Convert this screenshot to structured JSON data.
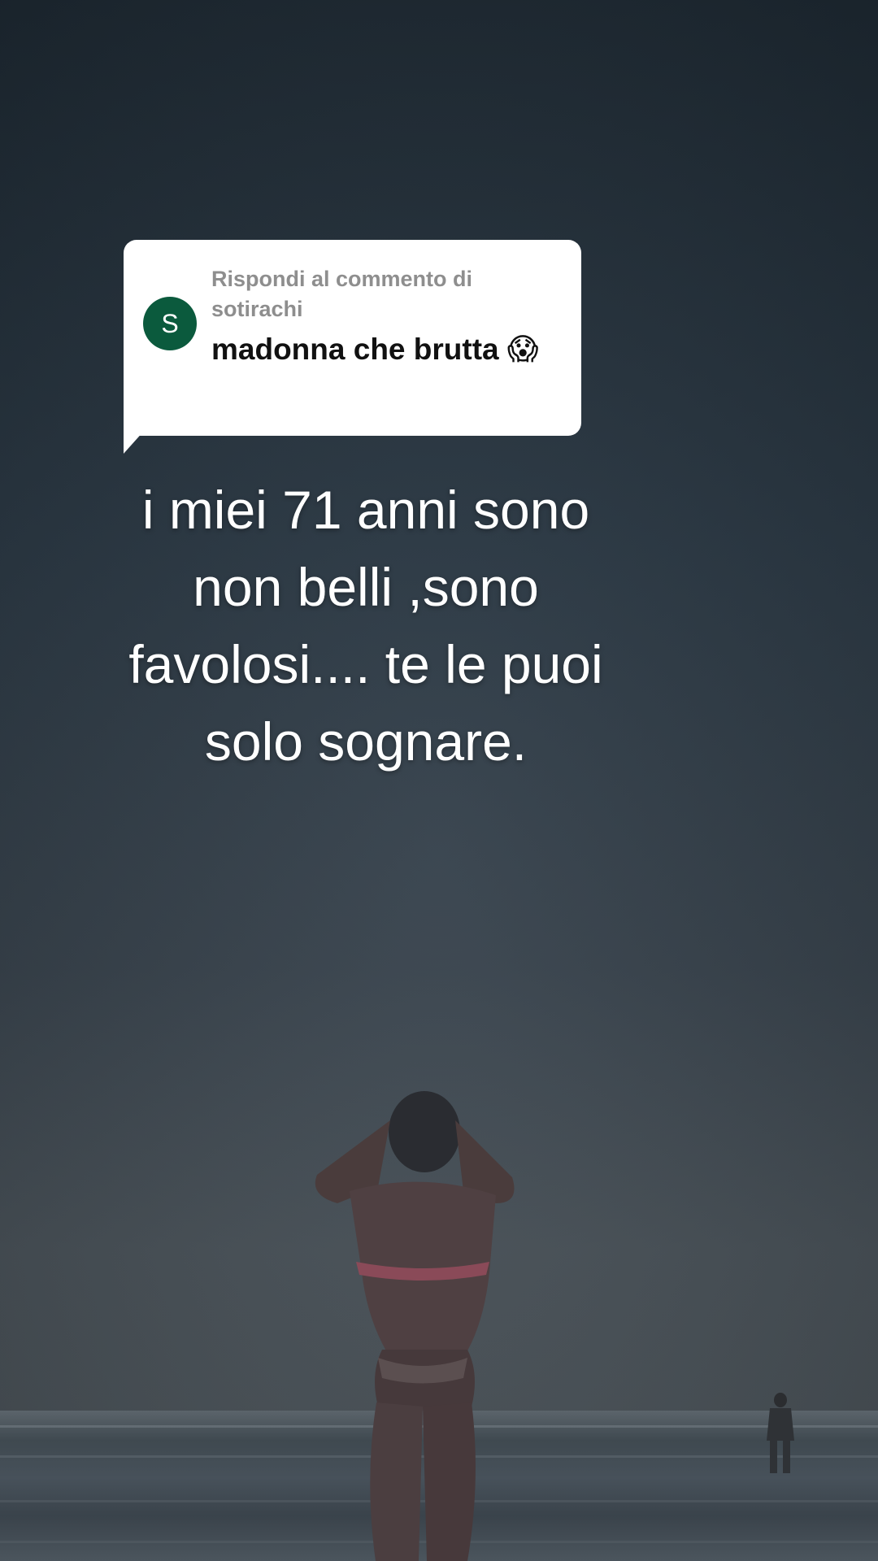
{
  "comment_reply": {
    "label": "Rispondi al commento di sotirachi",
    "avatar_letter": "S",
    "text": "madonna che brutta 😱",
    "avatar_color": "#0b5a3d"
  },
  "caption": {
    "text": "i miei 71 anni sono\nnon belli ,sono\nfavolosi.... te le puoi\nsolo  sognare."
  }
}
